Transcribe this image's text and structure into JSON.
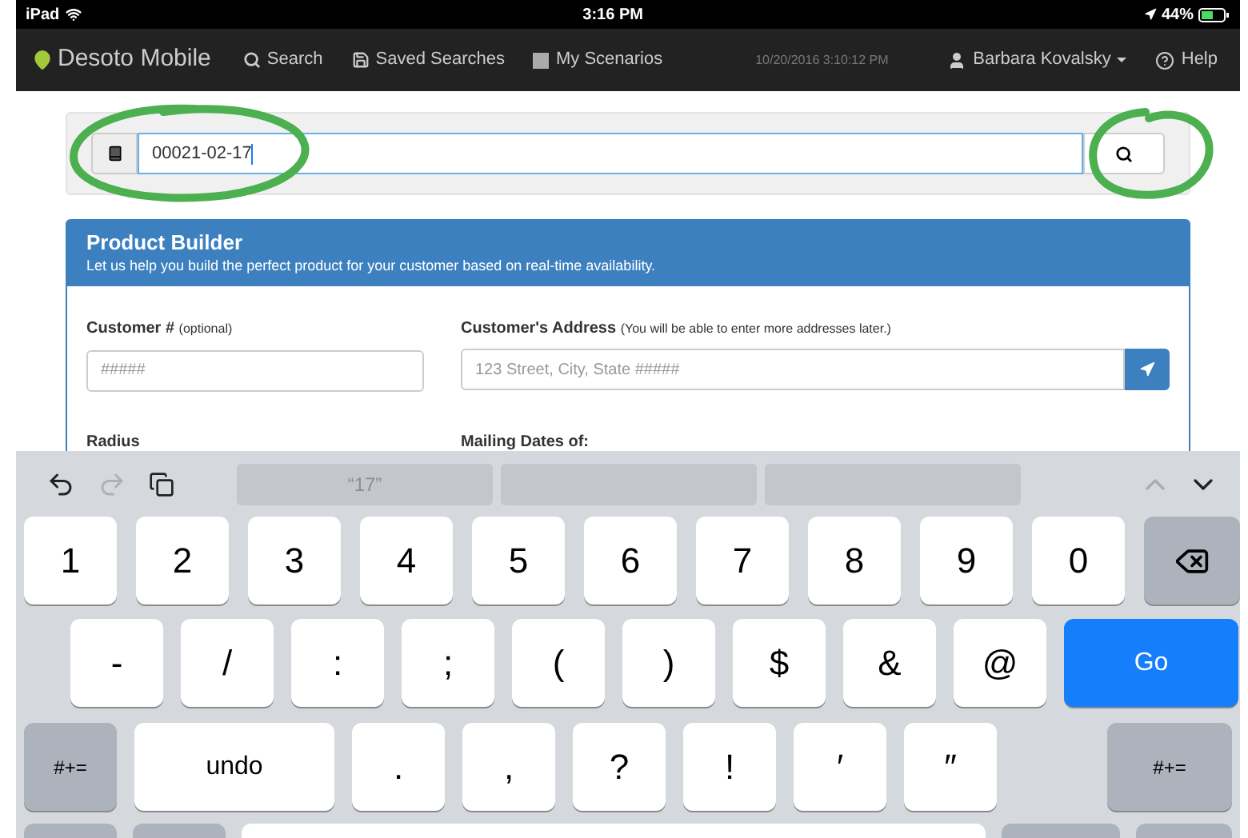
{
  "status_bar": {
    "device": "iPad",
    "time": "3:16 PM",
    "battery": "44%"
  },
  "nav": {
    "brand": "Desoto Mobile",
    "items": [
      {
        "label": "Search",
        "kind": "search"
      },
      {
        "label": "Saved Searches",
        "kind": "saved"
      },
      {
        "label": "My Scenarios",
        "kind": "scenarios"
      }
    ],
    "timestamp": "10/20/2016 3:10:12 PM",
    "user": "Barbara Kovalsky",
    "help": "Help"
  },
  "search": {
    "value": "00021-02-17",
    "focused": true
  },
  "panel": {
    "title": "Product Builder",
    "subtitle": "Let us help you build the perfect product for your customer based on real-time availability.",
    "fields": [
      {
        "label": "Customer #",
        "note": "(optional)",
        "placeholder": "#####",
        "kind": "text"
      },
      {
        "label": "Customer's Address",
        "note": "(You will be able to enter more addresses later.)",
        "placeholder": "123 Street, City, State #####",
        "kind": "locate"
      }
    ],
    "labels": [
      "Radius",
      "Mailing Dates of:"
    ]
  },
  "keyboard": {
    "tools": [
      {
        "kind": "undo",
        "disabled": false
      },
      {
        "kind": "redo",
        "disabled": true
      },
      {
        "kind": "paste",
        "disabled": false
      }
    ],
    "suggestions": [
      {
        "kind": "text",
        "text": "“17”"
      },
      {
        "kind": "empty"
      },
      {
        "kind": "empty"
      }
    ],
    "nav_arrows": [
      {
        "kind": "up",
        "disabled": true
      },
      {
        "kind": "down",
        "disabled": false
      }
    ],
    "rows": [
      [
        {
          "label": "1",
          "kind": "char"
        },
        {
          "label": "2",
          "kind": "char"
        },
        {
          "label": "3",
          "kind": "char"
        },
        {
          "label": "4",
          "kind": "char"
        },
        {
          "label": "5",
          "kind": "char"
        },
        {
          "label": "6",
          "kind": "char"
        },
        {
          "label": "7",
          "kind": "char"
        },
        {
          "label": "8",
          "kind": "char"
        },
        {
          "label": "9",
          "kind": "char"
        },
        {
          "label": "0",
          "kind": "char"
        },
        {
          "kind": "delete"
        }
      ],
      [
        {
          "label": "-",
          "kind": "char"
        },
        {
          "label": "/",
          "kind": "char"
        },
        {
          "label": ":",
          "kind": "char"
        },
        {
          "label": ";",
          "kind": "char"
        },
        {
          "label": "(",
          "kind": "char"
        },
        {
          "label": ")",
          "kind": "char"
        },
        {
          "label": "$",
          "kind": "char"
        },
        {
          "label": "&",
          "kind": "char"
        },
        {
          "label": "@",
          "kind": "char"
        },
        {
          "label": "Go",
          "kind": "go"
        }
      ],
      [
        {
          "label": "#+=",
          "kind": "shift"
        },
        {
          "label": "undo",
          "kind": "wide"
        },
        {
          "label": ".",
          "kind": "char"
        },
        {
          "label": ",",
          "kind": "char"
        },
        {
          "label": "?",
          "kind": "char"
        },
        {
          "label": "!",
          "kind": "char"
        },
        {
          "label": "′",
          "kind": "char"
        },
        {
          "label": "″",
          "kind": "char"
        },
        {
          "kind": "spacer"
        },
        {
          "label": "#+=",
          "kind": "shift_right"
        }
      ]
    ]
  }
}
